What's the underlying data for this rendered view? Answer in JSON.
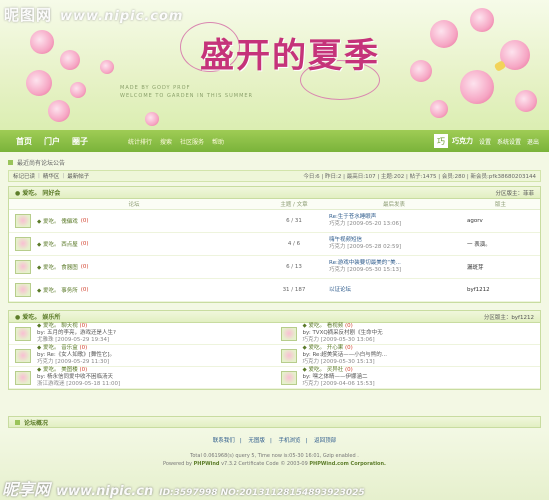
{
  "watermark": {
    "site": "昵图网",
    "url": "www.nipic.com",
    "bottom_site": "昵享网",
    "bottom_url": "www.nipic.cn",
    "bottom_id": "ID:3597998 NO:20131128154893923025"
  },
  "banner": {
    "title": "盛开的夏季",
    "sub1": "MADE BY GODY PROF",
    "sub2": "WELCOME TO GARDEN IN THIS SUMMER"
  },
  "nav": {
    "items": [
      "首页",
      "门户",
      "圈子"
    ],
    "sub": [
      "统计排行",
      "搜索",
      "社区服务",
      "帮助"
    ],
    "user_icon": "巧",
    "user_name": "巧克力",
    "links": [
      "设置",
      "系统设置",
      "退出"
    ]
  },
  "notice": "最近尚有论坛公告",
  "linkbar": {
    "left": [
      "标记已读",
      "精华区",
      "最新帖子"
    ],
    "stats": "今日:6 | 昨日:2 | 最高日:107 | 主题:202 | 帖子:1475 | 会员:280 | 新会员:pfk38680203144"
  },
  "cat1": {
    "title": "● 爱吃。  同好会 ",
    "mods": "分区版主：菲菲",
    "cols": [
      "论坛",
      "主题 / 文章",
      "最后发表",
      "版主"
    ],
    "rows": [
      {
        "name": "◆ 爱吃。 傀儡戏",
        "today": "(0)",
        "count": "6 / 31",
        "last": "Re:生于苍水睡眼声",
        "meta": "巧克力 [2009-05-20 13:06]",
        "mods": "agorv"
      },
      {
        "name": "◆ 爱吃。 西点屋",
        "today": "(0)",
        "count": "4 / 6",
        "last": "嗨午视频短信",
        "meta": "巧克力 [2009-05-28 02:59]",
        "mods": "一    表演。"
      },
      {
        "name": "◆ 爱吃。 食器图",
        "today": "(0)",
        "count": "6 / 13",
        "last": "Re:游戏中装要切最美的“美...",
        "meta": "巧克力 [2009-05-30 15:13]",
        "mods": "漏斑芽"
      },
      {
        "name": "◆ 爱吃。 事务所",
        "today": "(0)",
        "count": "31 / 187",
        "last": "以证论坛",
        "meta": "",
        "mods": "byf1212"
      }
    ]
  },
  "cat2": {
    "title": "● 爱吃。  娱乐所 ",
    "mods": "分区版主：byf1212",
    "cells": [
      {
        "name": "◆ 爱吃。 聊天视 ",
        "today": "(0)",
        "by": "by: 五月的李亮，游戏还是人生?",
        "meta": "尤雅珠 [2009-05-29 19:34]"
      },
      {
        "name": "◆ 爱吃。 看视频 ",
        "today": "(0)",
        "by": "by: TVXQ摘采反村剧《生命中无",
        "meta": "巧克力 [2009-05-30 13:06]"
      },
      {
        "name": "◆ 爱吃。 音乐盒 ",
        "today": "(0)",
        "by": "by: Re:《女人如歌》[舞性它]。",
        "meta": "巧克力 [2009-05-29 11:30]"
      },
      {
        "name": "◆ 爱吃。 开心果 ",
        "today": "(0)",
        "by": "by: Re:超美笑话——小白与熊的...",
        "meta": "巧克力 [2009-05-30 15:13]"
      },
      {
        "name": "◆ 爱吃。 美图楼 ",
        "today": "(0)",
        "by": "by: 杨永信同爱中收不困临汤天",
        "meta": "浙江游戏迷 [2009-05-18 11:00]"
      },
      {
        "name": "◆ 爱吃。 灵异社 ",
        "today": "(0)",
        "by": "by: 嘿之体睛——伊娜涵二",
        "meta": "巧克力 [2009-04-06 15:53]"
      }
    ]
  },
  "online": "论坛概况",
  "footlinks": [
    "联系我们",
    "无图版",
    "手机浏览",
    "返回顶部"
  ],
  "footer": {
    "line1": "Total 0.061968(s) query 5, Time now is:05-30 16:01, Gzip enabled .",
    "line2_prefix": "Powered by",
    "line2_brand": "PHPWind",
    "line2_rest": "v7.3.2 Certificate Code © 2003-09",
    "line2_corp": "PHPWind.com Corporation."
  }
}
